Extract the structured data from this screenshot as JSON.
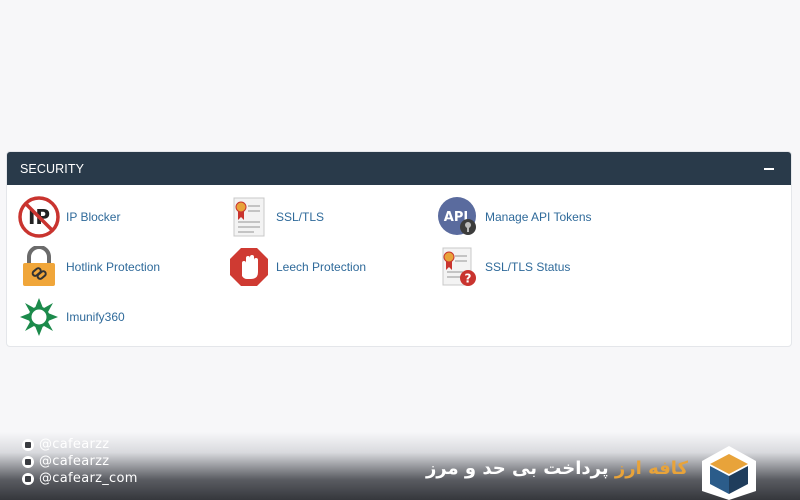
{
  "panel": {
    "title": "SECURITY",
    "items": [
      {
        "label": "IP Blocker",
        "icon": "ip-blocker-icon"
      },
      {
        "label": "SSL/TLS",
        "icon": "certificate-icon"
      },
      {
        "label": "Manage API Tokens",
        "icon": "api-tokens-icon"
      },
      {
        "label": "Hotlink Protection",
        "icon": "padlock-link-icon"
      },
      {
        "label": "Leech Protection",
        "icon": "stop-hand-icon"
      },
      {
        "label": "SSL/TLS Status",
        "icon": "certificate-question-icon"
      },
      {
        "label": "Imunify360",
        "icon": "imunify-star-icon"
      }
    ]
  },
  "footer": {
    "socials": [
      "@cafearzz",
      "@cafearzz",
      "@cafearz_com"
    ],
    "brand_accent": "کافه ارز",
    "brand_rest": " پرداخت بی حد و مرز"
  },
  "colors": {
    "header_bg": "#293a4a",
    "link": "#2f6a9a",
    "brand_accent": "#e8a33a"
  }
}
